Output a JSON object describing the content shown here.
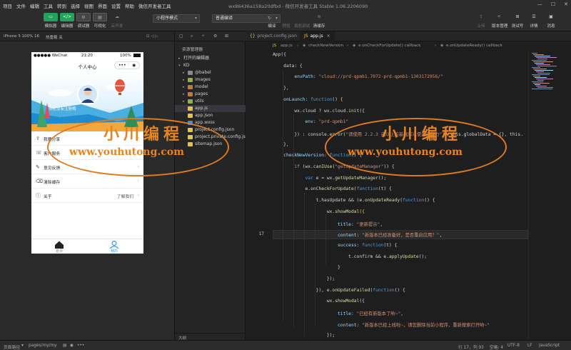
{
  "menubar": {
    "items": [
      "项目",
      "文件",
      "编辑",
      "工具",
      "转到",
      "选择",
      "视图",
      "界面",
      "设置",
      "帮助",
      "微信开发者工具"
    ],
    "window_title": "wx86436a158a20dfbd - 微信开发者工具 Stable 1.06.2206090"
  },
  "toolbar": {
    "simulator": "模拟器",
    "editor": "编辑器",
    "debugger": "调试器",
    "visual": "可视化",
    "cloud_dev": "云开发",
    "mode_select": "小程序模式",
    "compile_select": "普通编译",
    "compile": "编译",
    "preview": "预览",
    "real_debug": "真机调试",
    "clear_cache": "清缓存",
    "upload": "上传",
    "version_mgmt": "版本管理",
    "test_id": "测试号",
    "details": "详情",
    "messages": "消息"
  },
  "simulator": {
    "device": "iPhone 5 100% 16",
    "hot_reload": "热重载 关",
    "status_left": "●●●●● WeChat",
    "status_time": "21:20",
    "status_right": "100%",
    "nav_title": "个人中心",
    "nickname": "你还没有注册哦",
    "menu": [
      {
        "label": "我要分享",
        "value": ""
      },
      {
        "label": "客户服务",
        "value": ""
      },
      {
        "label": "意见反馈",
        "value": ""
      },
      {
        "label": "清除缓存",
        "value": ""
      },
      {
        "label": "关于",
        "value": "了解我们"
      }
    ],
    "tabs": [
      {
        "label": "首页",
        "active": false
      },
      {
        "label": "我的",
        "active": true
      }
    ]
  },
  "file_panel": {
    "header": "资源管理器",
    "open_editors": "打开的编辑器",
    "root": "KD",
    "tree": [
      {
        "name": "@babel",
        "kind": "folder",
        "color": "#8a8a8a"
      },
      {
        "name": "images",
        "kind": "folder",
        "color": "#8fb34a"
      },
      {
        "name": "model",
        "kind": "folder",
        "color": "#c27b3a"
      },
      {
        "name": "pages",
        "kind": "folder",
        "color": "#c27b3a"
      },
      {
        "name": "utils",
        "kind": "folder",
        "color": "#8fb34a"
      },
      {
        "name": "app.js",
        "kind": "js",
        "color": "#e6c44c"
      },
      {
        "name": "app.json",
        "kind": "json",
        "color": "#e6c44c"
      },
      {
        "name": "app.wxss",
        "kind": "wxss",
        "color": "#3b8eea"
      },
      {
        "name": "project.config.json",
        "kind": "json",
        "color": "#e6c44c"
      },
      {
        "name": "project.private.config.js...",
        "kind": "json",
        "color": "#e6c44c"
      },
      {
        "name": "sitemap.json",
        "kind": "json",
        "color": "#e6c44c"
      }
    ],
    "outline": "大纲"
  },
  "editor": {
    "tabs": [
      {
        "label": "project.config.json",
        "active": false
      },
      {
        "label": "app.js",
        "active": true
      }
    ],
    "breadcrumb": [
      "app.js",
      "checkNewVersion",
      "e.onCheckForUpdate() callback",
      "e.onUpdateReady() callback"
    ],
    "current_line_number": "17",
    "code_lines": [
      [
        [
          "App({",
          "pl"
        ]
      ],
      [
        [
          "    data: {",
          "pl"
        ]
      ],
      [
        [
          "        envPath: ",
          "p"
        ],
        [
          "\"cloud://prd-qpmb1.7072-prd-qpmb1-1303172956/\"",
          "s"
        ]
      ],
      [
        [
          "    },",
          "pl"
        ]
      ],
      [
        [
          "    onLaunch: ",
          "p"
        ],
        [
          "function",
          "kb"
        ],
        [
          "() {",
          "pl"
        ]
      ],
      [
        [
          "        wx.cloud ? wx.cloud.",
          "pl"
        ],
        [
          "init",
          "f"
        ],
        [
          "({",
          "pl"
        ]
      ],
      [
        [
          "            env: ",
          "p"
        ],
        [
          "\"prd-qpmb1\"",
          "s"
        ]
      ],
      [
        [
          "        }) : console.",
          "pl"
        ],
        [
          "error",
          "f"
        ],
        [
          "(",
          "pl"
        ],
        [
          "\"请使用 2.2.3 或以上的基础库以使用云能力\"",
          "s"
        ],
        [
          "), this.globalData = {}, this.",
          "pl"
        ]
      ],
      [
        [
          "    },",
          "pl"
        ]
      ],
      [
        [
          "    checkNewVersion: ",
          "p"
        ],
        [
          "function",
          "kb"
        ],
        [
          "() {",
          "pl"
        ]
      ],
      [
        [
          "        ",
          "pl"
        ],
        [
          "if",
          "k"
        ],
        [
          " (wx.",
          "pl"
        ],
        [
          "canIUse",
          "f"
        ],
        [
          "(",
          "pl"
        ],
        [
          "\"getUpdateManager\"",
          "s"
        ],
        [
          ")) {",
          "pl"
        ]
      ],
      [
        [
          "            ",
          "pl"
        ],
        [
          "var",
          "kb"
        ],
        [
          " e = wx.",
          "pl"
        ],
        [
          "getUpdateManager",
          "f"
        ],
        [
          "();",
          "pl"
        ]
      ],
      [
        [
          "            e.",
          "pl"
        ],
        [
          "onCheckForUpdate",
          "f"
        ],
        [
          "(",
          "pl"
        ],
        [
          "function",
          "kb"
        ],
        [
          "(t) {",
          "pl"
        ]
      ],
      [
        [
          "                t.hasUpdate && (e.",
          "pl"
        ],
        [
          "onUpdateReady",
          "f"
        ],
        [
          "(",
          "pl"
        ],
        [
          "function",
          "kb"
        ],
        [
          "() {",
          "pl"
        ]
      ],
      [
        [
          "                    wx.",
          "pl"
        ],
        [
          "showModal",
          "f"
        ],
        [
          "({",
          "y"
        ]
      ],
      [
        [
          "                        title: ",
          "p"
        ],
        [
          "\"更新提示\"",
          "s"
        ],
        [
          ",",
          "pl"
        ]
      ],
      [
        [
          "                        content: ",
          "p"
        ],
        [
          "\"新版本已经准备好，是否重启应用？\"",
          "s"
        ],
        [
          ",",
          "pl"
        ]
      ],
      [
        [
          "                        success: ",
          "p"
        ],
        [
          "function",
          "kb"
        ],
        [
          "(t) {",
          "pl"
        ]
      ],
      [
        [
          "                            t.confirm && e.",
          "pl"
        ],
        [
          "applyUpdate",
          "f"
        ],
        [
          "();",
          "pl"
        ]
      ],
      [
        [
          "                        }",
          "pl"
        ]
      ],
      [
        [
          "                    });",
          "pl"
        ]
      ],
      [
        [
          "                }), e.",
          "pl"
        ],
        [
          "onUpdateFailed",
          "f"
        ],
        [
          "(",
          "pl"
        ],
        [
          "function",
          "kb"
        ],
        [
          "() {",
          "pl"
        ]
      ],
      [
        [
          "                    wx.",
          "pl"
        ],
        [
          "showModal",
          "f"
        ],
        [
          "({",
          "pl"
        ]
      ],
      [
        [
          "                        title: ",
          "p"
        ],
        [
          "\"已经有新版本了哟~\"",
          "s"
        ],
        [
          ",",
          "pl"
        ]
      ],
      [
        [
          "                        content: ",
          "p"
        ],
        [
          "\"新版本已经上线啦~，请您删除当前小程序，重新搜索打开哟~\"",
          "s"
        ]
      ],
      [
        [
          "                    });",
          "pl"
        ]
      ]
    ]
  },
  "watermark": {
    "cn": "小川编程",
    "url": "www.youhutong.com"
  },
  "statusbar": {
    "page_path_label": "页面路径",
    "page_path": "pages/my/my",
    "cursor": "行 17，列 93",
    "spaces": "空格: 4",
    "encoding": "UTF-8",
    "eol": "LF",
    "language": "JavaScript"
  },
  "colors": {
    "accent_green": "#20a35a",
    "tab_active_blue": "#2a9bff",
    "watermark_orange": "#e07a1f"
  }
}
